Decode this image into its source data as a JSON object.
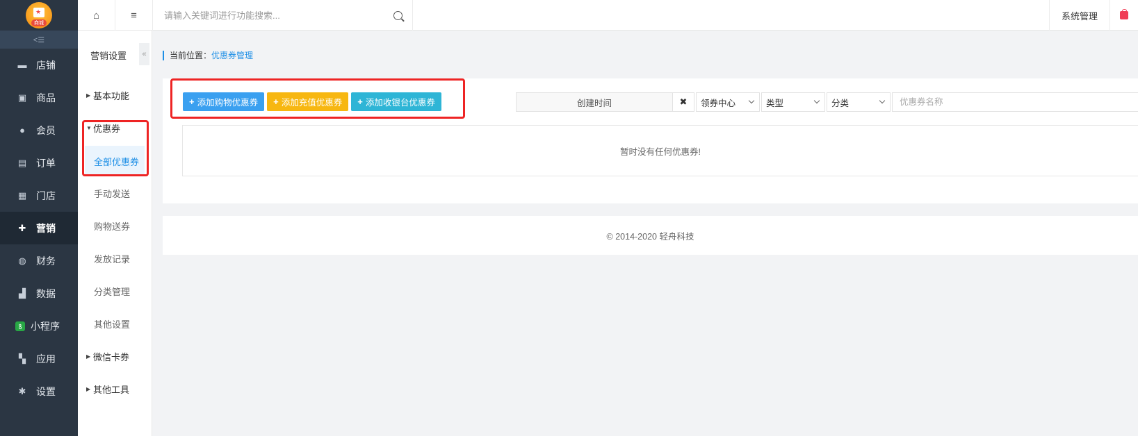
{
  "brand": {
    "logo_text": "商城"
  },
  "leftnav": {
    "collapse_label": "<☰",
    "items": [
      {
        "label": "店铺",
        "icon": "store-icon",
        "glyph": "▬"
      },
      {
        "label": "商品",
        "icon": "product-icon",
        "glyph": "▣"
      },
      {
        "label": "会员",
        "icon": "user-icon",
        "glyph": "●"
      },
      {
        "label": "订单",
        "icon": "order-icon",
        "glyph": "▤"
      },
      {
        "label": "门店",
        "icon": "shop-icon",
        "glyph": "▦"
      },
      {
        "label": "营销",
        "icon": "gift-icon",
        "glyph": "✚"
      },
      {
        "label": "财务",
        "icon": "money-bag-icon",
        "glyph": "◍"
      },
      {
        "label": "数据",
        "icon": "chart-icon",
        "glyph": "▟"
      },
      {
        "label": "小程序",
        "icon": "miniprogram-icon",
        "glyph": "ꝸ"
      },
      {
        "label": "应用",
        "icon": "apps-icon",
        "glyph": "▚"
      },
      {
        "label": "设置",
        "icon": "gear-icon",
        "glyph": "✱"
      }
    ],
    "active_index": 5
  },
  "submenu": {
    "title": "营销设置",
    "collapse_glyph": "«",
    "groups": [
      {
        "label": "基本功能",
        "expanded": false,
        "children": []
      },
      {
        "label": "优惠券",
        "expanded": true,
        "children": [
          "全部优惠券",
          "手动发送",
          "购物送券",
          "发放记录",
          "分类管理",
          "其他设置"
        ]
      },
      {
        "label": "微信卡券",
        "expanded": false,
        "children": []
      },
      {
        "label": "其他工具",
        "expanded": false,
        "children": []
      }
    ],
    "active_child": "全部优惠券"
  },
  "topbar": {
    "home_glyph": "⌂",
    "menu_glyph": "≡",
    "search_placeholder": "请输入关键词进行功能搜索...",
    "system_label": "系统管理"
  },
  "breadcrumb": {
    "prefix": "当前位置：",
    "current": "优惠券管理"
  },
  "actions": {
    "add_shopping": "添加购物优惠券",
    "add_recharge": "添加充值优惠券",
    "add_cashier": "添加收银台优惠券",
    "colors": {
      "blue": "#3aa0f0",
      "yellow": "#f7b711",
      "cyan": "#2eb5d6",
      "highlight": "#ee2424"
    }
  },
  "filters": {
    "date_label": "创建时间",
    "clear_glyph": "✖",
    "select_center": "领券中心",
    "select_type": "类型",
    "select_category": "分类",
    "name_placeholder": "优惠券名称"
  },
  "table": {
    "empty_text": "暂时没有任何优惠券!"
  },
  "footer": {
    "text": "© 2014-2020 轻舟科技"
  }
}
